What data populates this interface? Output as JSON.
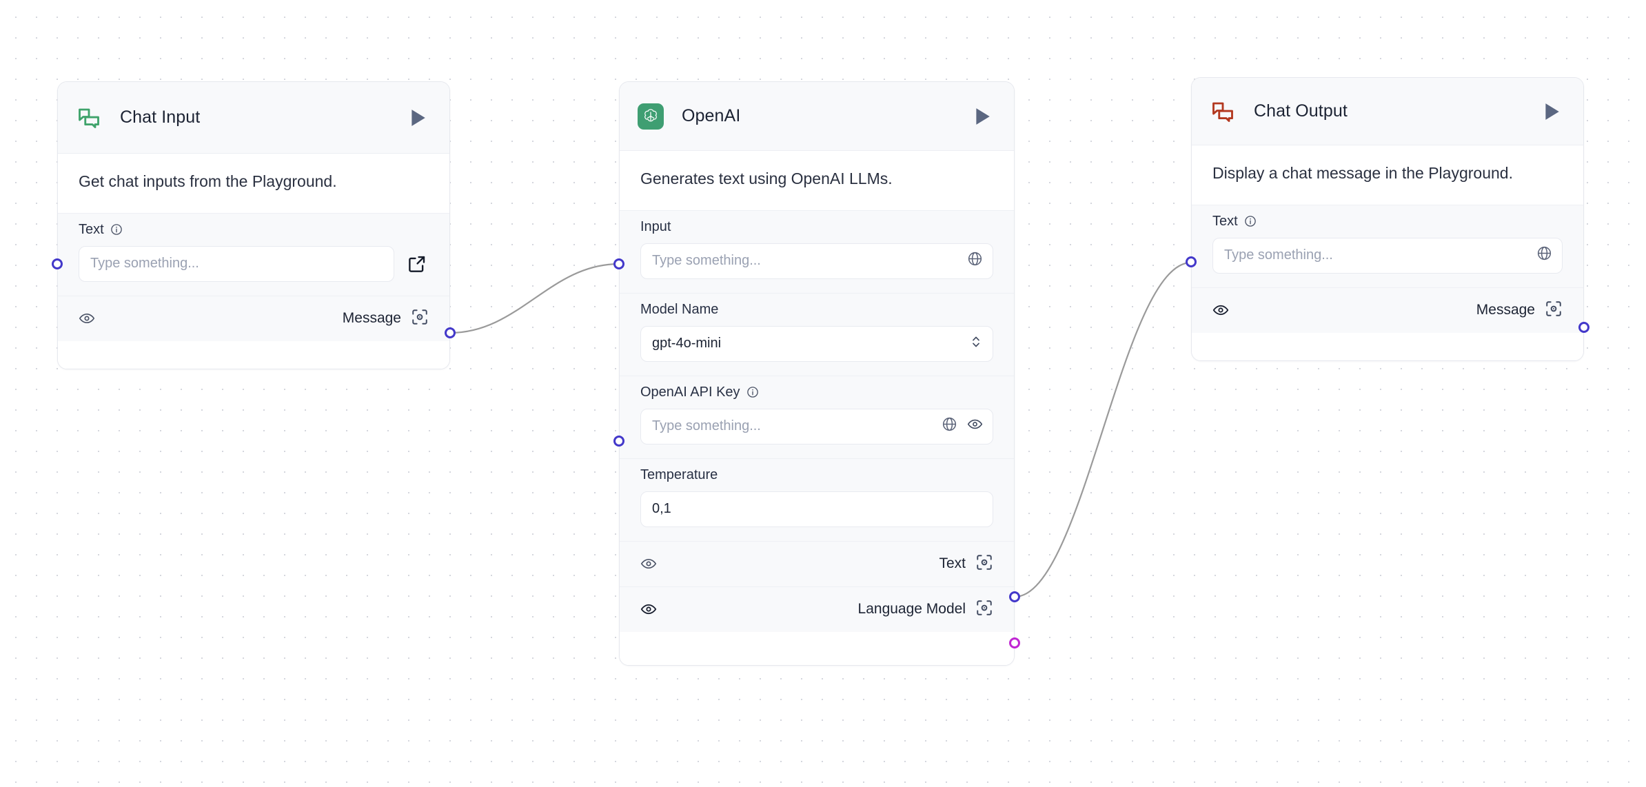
{
  "canvas": {
    "background_color": "#ffffff",
    "dot_color": "#d4d6dd",
    "edge_color": "#9a9a9a"
  },
  "colors": {
    "handle_message": "#4338ca",
    "handle_language_model": "#c026d3",
    "chat_input_icon": "#3fa36b",
    "chat_output_icon": "#b3381f",
    "openai_badge": "#3f9e72",
    "play_button": "#5b6781",
    "node_header_bg": "#f8f9fb",
    "node_border": "#e6e8ee"
  },
  "nodes": [
    {
      "id": "chat-input",
      "title": "Chat Input",
      "icon": "chat-bubbles-icon",
      "description": "Get chat inputs from the Playground.",
      "run_button": "run-icon",
      "fields": [
        {
          "label": "Text",
          "has_info": true,
          "info_icon": "info-icon",
          "placeholder": "Type something...",
          "value": "",
          "trailing_icons": [],
          "external_icon": "external-link-icon"
        }
      ],
      "outputs": [
        {
          "label": "Message",
          "eye_icon": "eye-icon",
          "scan_icon": "scan-target-icon",
          "handle_color": "#4338ca"
        }
      ]
    },
    {
      "id": "openai",
      "title": "OpenAI",
      "icon": "openai-logo-icon",
      "description": "Generates text using OpenAI LLMs.",
      "run_button": "run-icon",
      "fields": [
        {
          "label": "Input",
          "has_info": false,
          "placeholder": "Type something...",
          "value": "",
          "trailing_icons": [
            "globe-icon"
          ],
          "has_input_handle": true
        },
        {
          "label": "Model Name",
          "has_info": false,
          "placeholder": "",
          "value": "gpt-4o-mini",
          "trailing_icons": [
            "chevron-up-down-icon"
          ]
        },
        {
          "label": "OpenAI API Key",
          "has_info": true,
          "info_icon": "info-icon",
          "placeholder": "Type something...",
          "value": "",
          "trailing_icons": [
            "globe-icon",
            "eye-icon"
          ],
          "has_input_handle": true
        },
        {
          "label": "Temperature",
          "has_info": false,
          "placeholder": "",
          "value": "0,1",
          "trailing_icons": []
        }
      ],
      "outputs": [
        {
          "label": "Text",
          "eye_icon": "eye-icon",
          "scan_icon": "scan-target-icon",
          "handle_color": "#4338ca"
        },
        {
          "label": "Language Model",
          "eye_icon": "eye-icon",
          "scan_icon": "scan-target-icon",
          "handle_color": "#c026d3"
        }
      ]
    },
    {
      "id": "chat-output",
      "title": "Chat Output",
      "icon": "chat-bubbles-icon",
      "description": "Display a chat message in the Playground.",
      "run_button": "run-icon",
      "fields": [
        {
          "label": "Text",
          "has_info": true,
          "info_icon": "info-icon",
          "placeholder": "Type something...",
          "value": "",
          "trailing_icons": [
            "globe-icon"
          ],
          "has_input_handle": true
        }
      ],
      "outputs": [
        {
          "label": "Message",
          "eye_icon": "eye-icon",
          "scan_icon": "scan-target-icon",
          "handle_color": "#4338ca"
        }
      ]
    }
  ],
  "edges": [
    {
      "from": "chat-input.Message",
      "to": "openai.Input"
    },
    {
      "from": "openai.Text",
      "to": "chat-output.Text"
    }
  ]
}
